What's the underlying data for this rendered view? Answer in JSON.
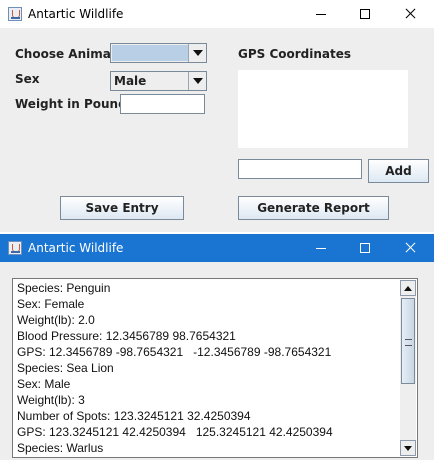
{
  "form_window": {
    "title": "Antartic Wildlife",
    "choose_animal_label": "Choose Animal",
    "choose_animal_value": "",
    "sex_label": "Sex",
    "sex_value": "Male",
    "weight_label": "Weight in Pounds",
    "weight_value": "",
    "gps_label": "GPS Coordinates",
    "gps_input_value": "",
    "add_button": "Add",
    "save_button": "Save Entry",
    "report_button": "Generate Report",
    "colors": {
      "selection": "#b8cfe5"
    }
  },
  "report_window": {
    "title": "Antartic Wildlife",
    "lines": [
      "Species: Penguin",
      "Sex: Female",
      "Weight(lb): 2.0",
      "Blood Pressure: 12.3456789 98.7654321",
      "GPS: 12.3456789 -98.7654321   -12.3456789 -98.7654321",
      "Species: Sea Lion",
      "Sex: Male",
      "Weight(lb): 3",
      "Number of Spots: 123.3245121 32.4250394",
      "GPS: 123.3245121 42.4250394   125.3245121 42.4250394",
      "Species: Warlus"
    ],
    "colors": {
      "titlebar": "#1974d2"
    }
  }
}
